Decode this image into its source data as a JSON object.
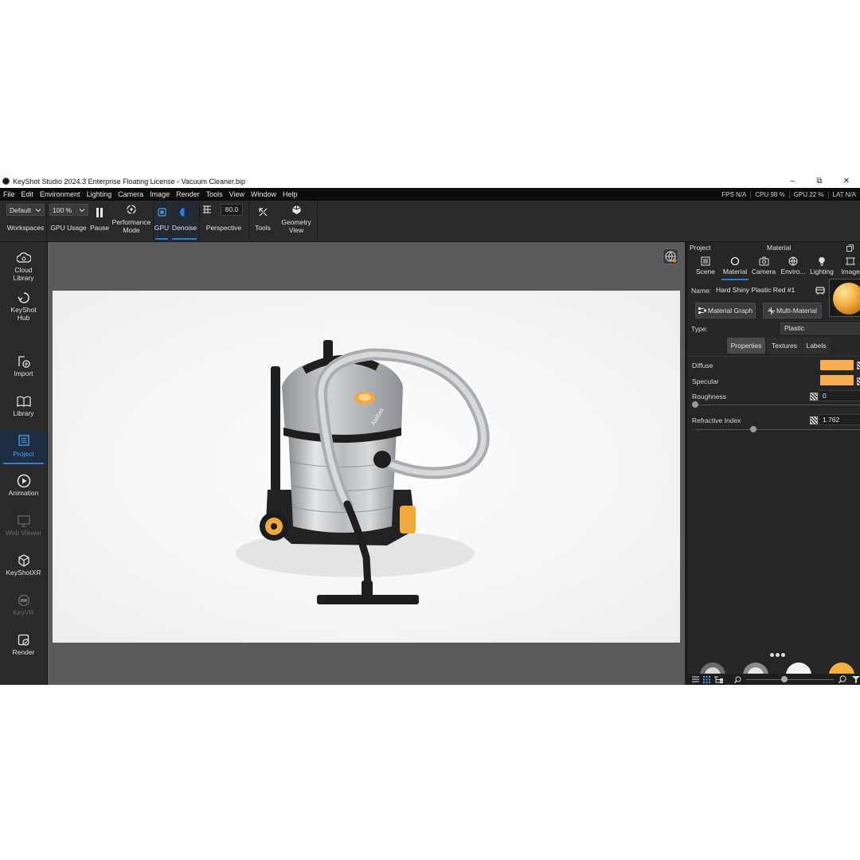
{
  "window": {
    "title": "KeyShot Studio 2024.3 Enterprise Floating License  - Vacuum Cleaner.bip",
    "min": "–",
    "max": "⧉",
    "close": "✕"
  },
  "menu": [
    "File",
    "Edit",
    "Environment",
    "Lighting",
    "Camera",
    "Image",
    "Render",
    "Tools",
    "View",
    "Window",
    "Help"
  ],
  "stats": [
    "FPS N/A",
    "CPU 98 %",
    "GPU 22 %",
    "LAT N/A"
  ],
  "toolbar": {
    "workspace_value": "Default",
    "workspace_label": "Workspaces",
    "gpu_usage_value": "100 %",
    "gpu_usage_label": "GPU Usage",
    "pause_label": "Pause",
    "performance_label_1": "Performance",
    "performance_label_2": "Mode",
    "gpu_label": "GPU",
    "denoise_label": "Denoise",
    "perspective_value": "80.0",
    "perspective_label": "Perspective",
    "tools_label": "Tools",
    "geometry_label_1": "Geometry",
    "geometry_label_2": "View"
  },
  "sidebar": [
    {
      "line1": "Cloud",
      "line2": "Library",
      "icon": "cloud-library-icon",
      "state": "normal"
    },
    {
      "line1": "KeyShot",
      "line2": "Hub",
      "icon": "hub-icon",
      "state": "normal"
    },
    {
      "line1": "Import",
      "line2": "",
      "icon": "import-icon",
      "state": "normal"
    },
    {
      "line1": "Library",
      "line2": "",
      "icon": "library-icon",
      "state": "normal"
    },
    {
      "line1": "Project",
      "line2": "",
      "icon": "project-icon",
      "state": "active"
    },
    {
      "line1": "Animation",
      "line2": "",
      "icon": "animation-icon",
      "state": "normal"
    },
    {
      "line1": "Web Viewer",
      "line2": "",
      "icon": "web-viewer-icon",
      "state": "dim"
    },
    {
      "line1": "KeyShotXR",
      "line2": "",
      "icon": "keyshotxr-icon",
      "state": "normal"
    },
    {
      "line1": "KeyVR",
      "line2": "",
      "icon": "keyvr-icon",
      "state": "dim"
    },
    {
      "line1": "Render",
      "line2": "",
      "icon": "render-icon",
      "state": "normal"
    }
  ],
  "viewport": {
    "product_brand": "Alaltas"
  },
  "panel": {
    "project_label": "Project",
    "material_heading": "Material",
    "tabs": [
      "Scene",
      "Material",
      "Camera",
      "Enviro...",
      "Lighting",
      "Image"
    ],
    "name_label": "Name:",
    "name_value": "Hard Shiny Plastic Red #1",
    "material_graph": "Material Graph",
    "multi_material": "Multi-Material",
    "type_label": "Type:",
    "type_value": "Plastic",
    "subtabs": [
      "Properties",
      "Textures",
      "Labels"
    ],
    "diffuse_label": "Diffuse",
    "specular_label": "Specular",
    "roughness_label": "Roughness",
    "roughness_value": "0",
    "roughness_level": 0,
    "refractive_label": "Refractive Index",
    "refractive_value": "1.762",
    "refractive_level": 0.35,
    "swatch_color": "#f7ae55",
    "accent_color": "#2f7fd6"
  }
}
